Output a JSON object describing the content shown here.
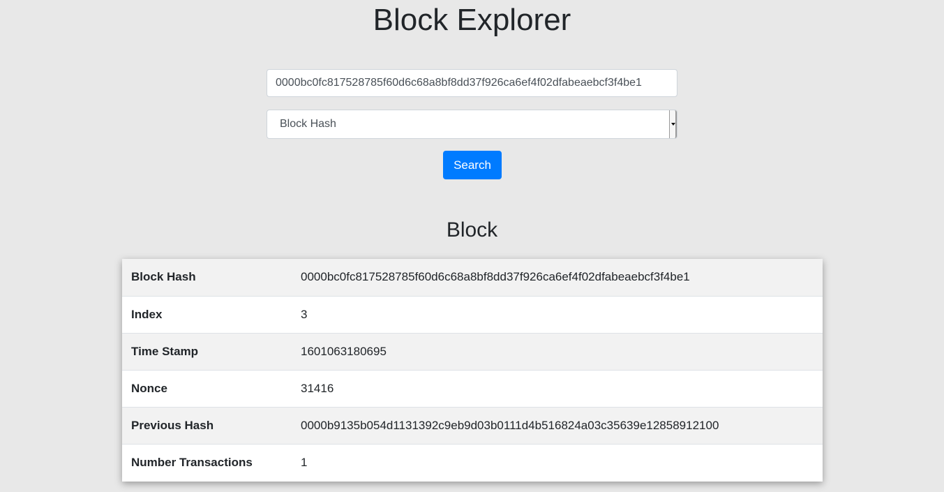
{
  "page": {
    "title": "Block Explorer"
  },
  "search": {
    "input_value": "0000bc0fc817528785f60d6c68a8bf8dd37f926ca6ef4f02dfabeaebcf3f4be1",
    "select_value": "Block Hash",
    "button_label": "Search"
  },
  "block": {
    "heading": "Block",
    "rows": [
      {
        "label": "Block Hash",
        "value": "0000bc0fc817528785f60d6c68a8bf8dd37f926ca6ef4f02dfabeaebcf3f4be1"
      },
      {
        "label": "Index",
        "value": "3"
      },
      {
        "label": "Time Stamp",
        "value": "1601063180695"
      },
      {
        "label": "Nonce",
        "value": "31416"
      },
      {
        "label": "Previous Hash",
        "value": "0000b9135b054d1131392c9eb9d03b0111d4b516824a03c35639e12858912100"
      },
      {
        "label": "Number Transactions",
        "value": "1"
      }
    ]
  },
  "colors": {
    "background": "#e8e8e8",
    "accent": "#007bff",
    "stripe": "#f2f2f2"
  },
  "icons": {
    "select_arrow": "chevron-down-icon"
  }
}
